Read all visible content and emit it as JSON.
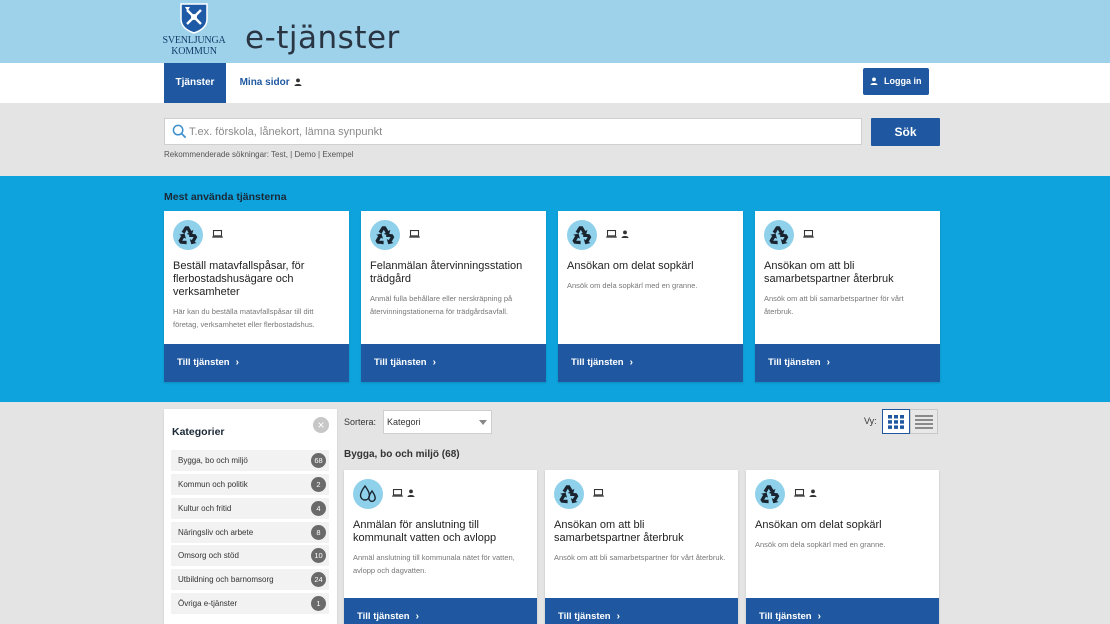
{
  "header": {
    "logo_line1": "SVENLJUNGA",
    "logo_line2": "KOMMUN",
    "site_title": "e-tjänster"
  },
  "nav": {
    "tab_services": "Tjänster",
    "tab_mine": "Mina sidor",
    "login_label": "Logga in"
  },
  "search": {
    "placeholder": "T.ex. förskola, lånekort, lämna synpunkt",
    "button": "Sök",
    "recommended_label": "Rekommenderade sökningar:",
    "recommended": [
      "Test",
      "Demo",
      "Exempel"
    ]
  },
  "popular": {
    "title": "Mest använda tjänsterna",
    "cards": [
      {
        "title": "Beställ matavfallspåsar, för flerbostadshusägare och verksamheter",
        "desc": "Här kan du beställa matavfallspåsar till ditt företag, verksamhetet eller flerbostadshus.",
        "link": "Till tjänsten",
        "icon": "recycle-icon",
        "badges": [
          "computer-icon"
        ]
      },
      {
        "title": "Felanmälan återvinningsstation trädgård",
        "desc": "Anmäl fulla behållare eller nerskräpning på återvinningstationerna för trädgårdsavfall.",
        "link": "Till tjänsten",
        "icon": "recycle-icon",
        "badges": [
          "computer-icon"
        ]
      },
      {
        "title": "Ansökan om delat sopkärl",
        "desc": "Ansök om dela sopkärl med en granne.",
        "link": "Till tjänsten",
        "icon": "recycle-icon",
        "badges": [
          "computer-icon",
          "person-icon"
        ]
      },
      {
        "title": "Ansökan om att bli samarbetspartner återbruk",
        "desc": "Ansök om att bli samarbetspartner för vårt återbruk.",
        "link": "Till tjänsten",
        "icon": "recycle-icon",
        "badges": [
          "computer-icon"
        ]
      }
    ]
  },
  "categories": {
    "title": "Kategorier",
    "items": [
      {
        "label": "Bygga, bo och miljö",
        "count": "68"
      },
      {
        "label": "Kommun och politik",
        "count": "2"
      },
      {
        "label": "Kultur och fritid",
        "count": "4"
      },
      {
        "label": "Näringsliv och arbete",
        "count": "8"
      },
      {
        "label": "Omsorg och stöd",
        "count": "10"
      },
      {
        "label": "Utbildning och barnomsorg",
        "count": "24"
      },
      {
        "label": "Övriga e-tjänster",
        "count": "1"
      }
    ]
  },
  "listing": {
    "sort_label": "Sortera:",
    "sort_value": "Kategori",
    "view_label": "Vy:",
    "group_title": "Bygga, bo och miljö",
    "group_count": "(68)",
    "cards": [
      {
        "title": "Anmälan för anslutning till kommunalt vatten och avlopp",
        "desc": "Anmäl anslutning till kommunala nätet för vatten, avlopp och dagvatten.",
        "link": "Till tjänsten",
        "icon": "water-drops-icon",
        "badges": [
          "computer-icon",
          "person-icon"
        ]
      },
      {
        "title": "Ansökan om att bli samarbetspartner återbruk",
        "desc": "Ansök om att bli samarbetspartner för vårt återbruk.",
        "link": "Till tjänsten",
        "icon": "recycle-icon",
        "badges": [
          "computer-icon"
        ]
      },
      {
        "title": "Ansökan om delat sopkärl",
        "desc": "Ansök om dela sopkärl med en granne.",
        "link": "Till tjänsten",
        "icon": "recycle-icon",
        "badges": [
          "computer-icon",
          "person-icon"
        ]
      }
    ]
  },
  "colors": {
    "header_bg": "#9dd2ea",
    "primary_blue": "#1f58a0",
    "band_blue": "#0ea3dc",
    "icon_circle": "#8fd0ea"
  }
}
